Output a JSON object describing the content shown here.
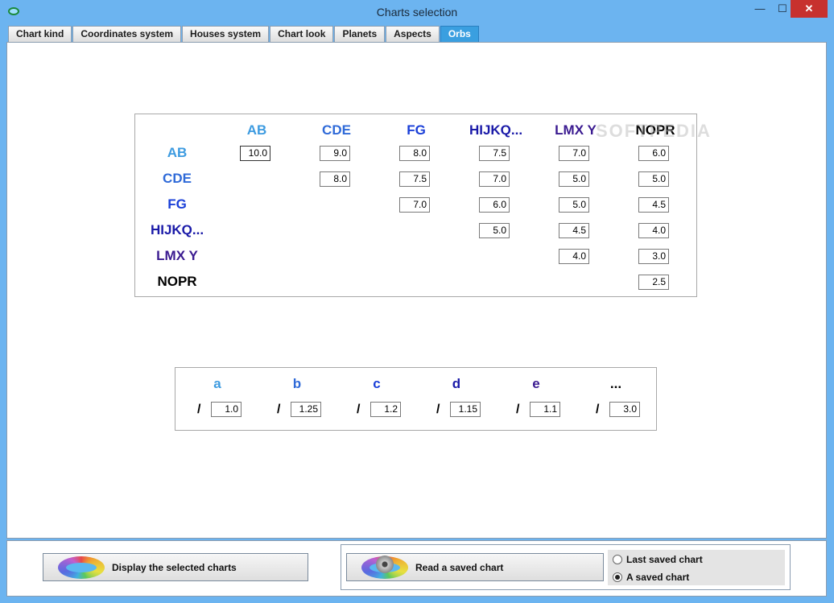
{
  "window": {
    "title": "Charts selection",
    "minimize": "—",
    "maximize": "☐",
    "close": "✕"
  },
  "tabs": [
    {
      "label": "Chart kind"
    },
    {
      "label": "Coordinates system"
    },
    {
      "label": "Houses system"
    },
    {
      "label": "Chart look"
    },
    {
      "label": "Planets"
    },
    {
      "label": "Aspects"
    },
    {
      "label": "Orbs",
      "active": true
    }
  ],
  "orbs": {
    "columns": [
      {
        "label": "AB",
        "color": "#3d9be0"
      },
      {
        "label": "CDE",
        "color": "#2f6ad8"
      },
      {
        "label": "FG",
        "color": "#1a3fd8"
      },
      {
        "label": "HIJKQ...",
        "color": "#1a1aa8"
      },
      {
        "label": "LMX Y",
        "color": "#3a1a90"
      },
      {
        "label": "NOPR",
        "color": "#000000"
      }
    ],
    "rows": [
      {
        "label": "AB",
        "color": "#3d9be0",
        "values": [
          "10.0",
          "9.0",
          "8.0",
          "7.5",
          "7.0",
          "6.0"
        ]
      },
      {
        "label": "CDE",
        "color": "#2f6ad8",
        "values": [
          "8.0",
          "7.5",
          "7.0",
          "5.0",
          "5.0"
        ]
      },
      {
        "label": "FG",
        "color": "#1a3fd8",
        "values": [
          "7.0",
          "6.0",
          "5.0",
          "4.5"
        ]
      },
      {
        "label": "HIJKQ...",
        "color": "#1a1aa8",
        "values": [
          "5.0",
          "4.5",
          "4.0"
        ]
      },
      {
        "label": "LMX Y",
        "color": "#3a1a90",
        "values": [
          "4.0",
          "3.0"
        ]
      },
      {
        "label": "NOPR",
        "color": "#000000",
        "values": [
          "2.5"
        ]
      }
    ]
  },
  "factors": [
    {
      "label": "a",
      "color": "#3d9be0",
      "value": "1.0"
    },
    {
      "label": "b",
      "color": "#2f6ad8",
      "value": "1.25"
    },
    {
      "label": "c",
      "color": "#1a3fd8",
      "value": "1.2"
    },
    {
      "label": "d",
      "color": "#1a1aa8",
      "value": "1.15"
    },
    {
      "label": "e",
      "color": "#3a1a90",
      "value": "1.1"
    },
    {
      "label": "...",
      "color": "#000000",
      "value": "3.0"
    }
  ],
  "slash": "/",
  "watermark": "SOFTPEDIA",
  "footer": {
    "display_button": "Display the selected charts",
    "read_button": "Read a saved chart",
    "radio_last": "Last saved chart",
    "radio_saved": "A saved chart",
    "selected_radio": "A saved chart"
  }
}
